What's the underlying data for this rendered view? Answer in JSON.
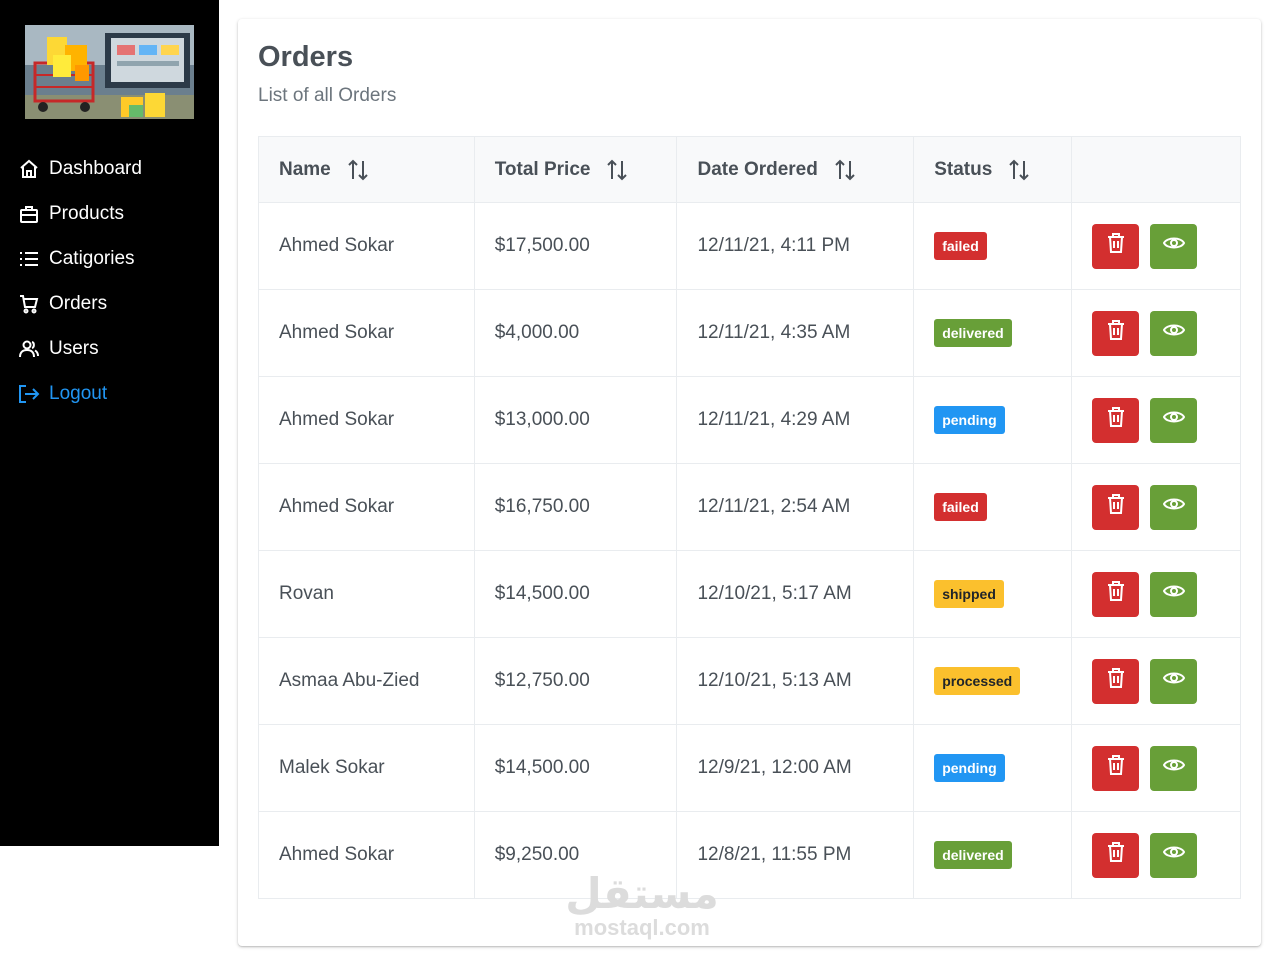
{
  "sidebar": {
    "logo_icon": "shopping-cart-photo",
    "items": [
      {
        "label": "Dashboard",
        "icon": "home-icon"
      },
      {
        "label": "Products",
        "icon": "briefcase-icon"
      },
      {
        "label": "Catigories",
        "icon": "list-icon"
      },
      {
        "label": "Orders",
        "icon": "cart-icon"
      },
      {
        "label": "Users",
        "icon": "users-icon"
      },
      {
        "label": "Logout",
        "icon": "logout-icon"
      }
    ]
  },
  "main": {
    "title": "Orders",
    "subtitle": "List of all Orders",
    "columns": [
      "Name",
      "Total Price",
      "Date Ordered",
      "Status"
    ],
    "rows": [
      {
        "name": "Ahmed Sokar",
        "price": "$17,500.00",
        "date": "12/11/21, 4:11 PM",
        "status": "failed"
      },
      {
        "name": "Ahmed Sokar",
        "price": "$4,000.00",
        "date": "12/11/21, 4:35 AM",
        "status": "delivered"
      },
      {
        "name": "Ahmed Sokar",
        "price": "$13,000.00",
        "date": "12/11/21, 4:29 AM",
        "status": "pending"
      },
      {
        "name": "Ahmed Sokar",
        "price": "$16,750.00",
        "date": "12/11/21, 2:54 AM",
        "status": "failed"
      },
      {
        "name": "Rovan",
        "price": "$14,500.00",
        "date": "12/10/21, 5:17 AM",
        "status": "shipped"
      },
      {
        "name": "Asmaa Abu-Zied",
        "price": "$12,750.00",
        "date": "12/10/21, 5:13 AM",
        "status": "processed"
      },
      {
        "name": "Malek Sokar",
        "price": "$14,500.00",
        "date": "12/9/21, 12:00 AM",
        "status": "pending"
      },
      {
        "name": "Ahmed Sokar",
        "price": "$9,250.00",
        "date": "12/8/21, 11:55 PM",
        "status": "delivered"
      }
    ]
  },
  "status_colors": {
    "failed": "#d32f2f",
    "delivered": "#689f38",
    "pending": "#2196f3",
    "shipped": "#fbc02d",
    "processed": "#fbc02d"
  },
  "watermark": {
    "arabic": "مستقل",
    "latin": "mostaql.com"
  }
}
